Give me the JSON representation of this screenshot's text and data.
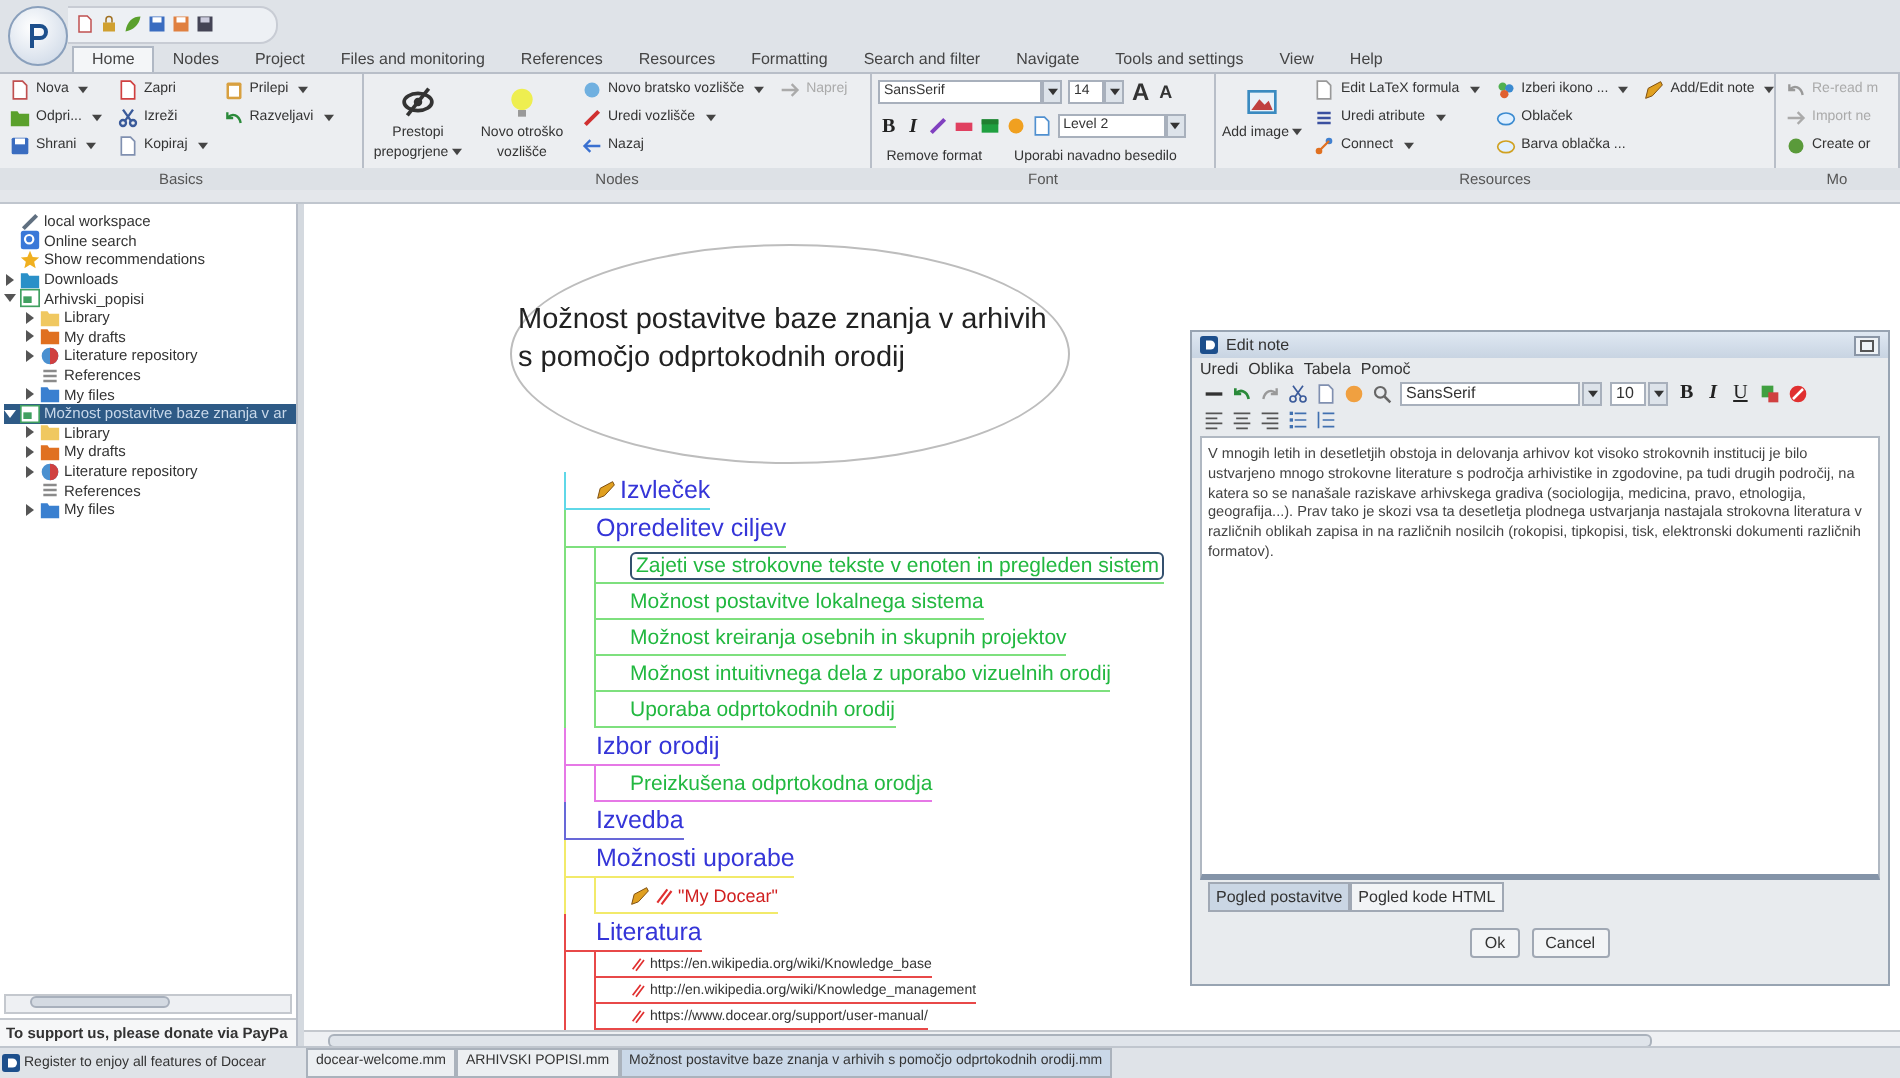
{
  "tabs": [
    {
      "label": "Home",
      "selected": true
    },
    {
      "label": "Nodes",
      "selected": false
    },
    {
      "label": "Project",
      "selected": false
    },
    {
      "label": "Files and monitoring",
      "selected": false
    },
    {
      "label": "References",
      "selected": false
    },
    {
      "label": "Resources",
      "selected": false
    },
    {
      "label": "Formatting",
      "selected": false
    },
    {
      "label": "Search and filter",
      "selected": false
    },
    {
      "label": "Navigate",
      "selected": false
    },
    {
      "label": "Tools and settings",
      "selected": false
    },
    {
      "label": "View",
      "selected": false
    },
    {
      "label": "Help",
      "selected": false
    }
  ],
  "ribbon": {
    "groups": [
      {
        "label": "Basics",
        "kind": "buttons",
        "columns": [
          {
            "kind": "small",
            "items": [
              {
                "label": "Nova",
                "kind": "new",
                "dropdown": true,
                "disabled": false
              },
              {
                "label": "Odpri...",
                "kind": "open",
                "dropdown": true,
                "disabled": false
              },
              {
                "label": "Shrani",
                "kind": "save",
                "dropdown": true,
                "disabled": false
              }
            ]
          },
          {
            "kind": "small",
            "items": [
              {
                "label": "Zapri",
                "kind": "close",
                "dropdown": false,
                "disabled": false
              },
              {
                "label": "Izreži",
                "kind": "cut",
                "dropdown": false,
                "disabled": false
              },
              {
                "label": "Kopiraj",
                "kind": "copy",
                "dropdown": true,
                "disabled": false
              }
            ]
          },
          {
            "kind": "small",
            "items": [
              {
                "label": "Prilepi",
                "kind": "paste",
                "dropdown": true,
                "disabled": false
              },
              {
                "label": "Razveljavi",
                "kind": "undo",
                "dropdown": true,
                "disabled": false
              }
            ]
          }
        ]
      },
      {
        "label": "Nodes",
        "kind": "buttons",
        "columns": [
          {
            "kind": "large",
            "items": [
              {
                "label": "Prestopi prepogrjene",
                "kind": "hide",
                "dropdown": true,
                "disabled": false
              }
            ]
          },
          {
            "kind": "large",
            "items": [
              {
                "label": "Novo otroško vozlišče",
                "kind": "child",
                "dropdown": false,
                "disabled": false
              }
            ]
          },
          {
            "kind": "small",
            "items": [
              {
                "label": "Novo bratsko vozlišče",
                "kind": "sibling",
                "dropdown": true,
                "disabled": false
              },
              {
                "label": "Uredi vozlišče",
                "kind": "edit",
                "dropdown": true,
                "disabled": false
              },
              {
                "label": "Nazaj",
                "kind": "back",
                "dropdown": false,
                "disabled": false
              }
            ]
          },
          {
            "kind": "small",
            "items": [
              {
                "label": "Naprej",
                "kind": "forward",
                "dropdown": false,
                "disabled": true
              }
            ]
          }
        ]
      },
      {
        "label": "Font",
        "kind": "font",
        "font_name": "SansSerif",
        "font_size": "14",
        "size_buttons": [
          "A",
          "A"
        ],
        "style_buttons": [
          "B",
          "I"
        ],
        "level": "Level 2",
        "actions": [
          "Remove format",
          "Uporabi navadno besedilo"
        ]
      },
      {
        "label": "Resources",
        "kind": "buttons",
        "columns": [
          {
            "kind": "large",
            "items": [
              {
                "label": "Add image",
                "kind": "image",
                "dropdown": true,
                "disabled": false
              }
            ]
          },
          {
            "kind": "small",
            "items": [
              {
                "label": "Edit LaTeX formula",
                "kind": "latex",
                "dropdown": true,
                "disabled": false
              },
              {
                "label": "Uredi atribute",
                "kind": "attributes",
                "dropdown": true,
                "disabled": false
              },
              {
                "label": "Connect",
                "kind": "connect",
                "dropdown": true,
                "disabled": false
              }
            ]
          },
          {
            "kind": "small",
            "items": [
              {
                "label": "Izberi ikono ...",
                "kind": "icon",
                "dropdown": true,
                "disabled": false
              },
              {
                "label": "Oblaček",
                "kind": "cloud",
                "dropdown": false,
                "disabled": false
              },
              {
                "label": "Barva oblačka ...",
                "kind": "cloudcolor",
                "dropdown": false,
                "disabled": false
              }
            ]
          },
          {
            "kind": "small",
            "items": [
              {
                "label": "Add/Edit note",
                "kind": "note",
                "dropdown": true,
                "disabled": false
              }
            ]
          }
        ]
      },
      {
        "label": "Mo",
        "kind": "buttons",
        "columns": [
          {
            "kind": "small",
            "items": [
              {
                "label": "Re-read m",
                "kind": "reread",
                "dropdown": false,
                "disabled": true
              },
              {
                "label": "Import ne",
                "kind": "import",
                "dropdown": false,
                "disabled": true
              },
              {
                "label": "Create or",
                "kind": "create",
                "dropdown": false,
                "disabled": false
              }
            ]
          }
        ]
      }
    ]
  },
  "sidebar": {
    "items": [
      {
        "label": "local workspace",
        "kind": "workspace",
        "selected": false
      },
      {
        "label": "Online search",
        "kind": "search",
        "selected": false
      },
      {
        "label": "Show recommendations",
        "kind": "star",
        "selected": false
      },
      {
        "label": "Downloads",
        "kind": "downloads",
        "selected": false,
        "expanded": false
      },
      {
        "label": "Arhivski_popisi",
        "kind": "project",
        "selected": false,
        "expanded": true,
        "children": [
          {
            "label": "Library",
            "kind": "library",
            "selected": false,
            "expanded": false
          },
          {
            "label": "My drafts",
            "kind": "drafts",
            "selected": false,
            "expanded": false
          },
          {
            "label": "Literature repository",
            "kind": "literature",
            "selected": false,
            "expanded": false
          },
          {
            "label": "References",
            "kind": "references",
            "selected": false
          },
          {
            "label": "My files",
            "kind": "files",
            "selected": false,
            "expanded": false
          }
        ]
      },
      {
        "label": "Možnost postavitve baze znanja v ar",
        "kind": "project",
        "selected": true,
        "expanded": true,
        "children": [
          {
            "label": "Library",
            "kind": "library",
            "selected": false,
            "expanded": false
          },
          {
            "label": "My drafts",
            "kind": "drafts",
            "selected": false,
            "expanded": false
          },
          {
            "label": "Literature repository",
            "kind": "literature",
            "selected": false,
            "expanded": false
          },
          {
            "label": "References",
            "kind": "references",
            "selected": false
          },
          {
            "label": "My files",
            "kind": "files",
            "selected": false,
            "expanded": false
          }
        ]
      }
    ],
    "footer": "To support us, please donate via PayPa"
  },
  "map": {
    "root": "Možnost postavitve baze znanja v arhivih s pomočjo odprtokodnih orodij",
    "nodes": [
      {
        "text": "Izvleček",
        "kind": "topic",
        "color": "#5fd8e8",
        "selected": false,
        "note": true
      },
      {
        "text": "Opredelitev ciljev",
        "kind": "topic",
        "color": "#7ee07e",
        "selected": false,
        "note": false,
        "children": [
          {
            "text": "Zajeti vse strokovne tekste v enoten in pregleden sistem",
            "kind": "topic",
            "color": "#7ee07e",
            "selected": true,
            "note": false
          },
          {
            "text": "Možnost postavitve lokalnega sistema",
            "kind": "topic",
            "color": "#7ee07e",
            "selected": false,
            "note": false
          },
          {
            "text": "Možnost kreiranja osebnih in skupnih projektov",
            "kind": "topic",
            "color": "#7ee07e",
            "selected": false,
            "note": false
          },
          {
            "text": "Možnost intuitivnega dela z uporabo vizuelnih orodij",
            "kind": "topic",
            "color": "#7ee07e",
            "selected": false,
            "note": false
          },
          {
            "text": "Uporaba odprtokodnih orodij",
            "kind": "topic",
            "color": "#7ee07e",
            "selected": false,
            "note": false
          }
        ]
      },
      {
        "text": "Izbor orodij",
        "kind": "topic",
        "color": "#e678e6",
        "selected": false,
        "note": false,
        "children": [
          {
            "text": "Preizkušena odprtokodna orodja",
            "kind": "topic",
            "color": "#e678e6",
            "selected": false,
            "note": false
          }
        ]
      },
      {
        "text": "Izvedba",
        "kind": "topic",
        "color": "#6868d8",
        "selected": false,
        "note": false
      },
      {
        "text": "Možnosti uporabe",
        "kind": "topic",
        "color": "#f2ea6a",
        "selected": false,
        "note": false,
        "children": [
          {
            "text": "\"My Docear\"",
            "kind": "reference",
            "color": "#f2ea6a",
            "selected": false,
            "note": true
          }
        ]
      },
      {
        "text": "Literatura",
        "kind": "topic",
        "color": "#e84848",
        "selected": false,
        "note": false,
        "children": [
          {
            "text": "https://en.wikipedia.org/wiki/Knowledge_base",
            "kind": "link",
            "color": "#e84848",
            "selected": false,
            "note": false
          },
          {
            "text": "http://en.wikipedia.org/wiki/Knowledge_management",
            "kind": "link",
            "color": "#e84848",
            "selected": false,
            "note": false
          },
          {
            "text": "https://www.docear.org/support/user-manual/",
            "kind": "link",
            "color": "#e84848",
            "selected": false,
            "note": false
          }
        ]
      }
    ]
  },
  "note_editor": {
    "title": "Edit note",
    "menu": [
      "Uredi",
      "Oblika",
      "Tabela",
      "Pomoč"
    ],
    "font_name": "SansSerif",
    "font_size": "10",
    "style_buttons": [
      "B",
      "I",
      "U"
    ],
    "text": "V mnogih letih in desetletjih obstoja in delovanja arhivov kot visoko strokovnih institucij je bilo ustvarjeno mnogo strokovne literature s področja arhivistike in zgodovine, pa tudi drugih področij, na katera so se nanašale raziskave arhivskega gradiva (sociologija, medicina, pravo, etnologija, geografija...). Prav tako je skozi vsa ta desetletja plodnega ustvarjanja nastajala strokovna literatura v različnih oblikah zapisa in na različnih nosilcih (rokopisi, tipkopisi, tisk, elektronski dokumenti različnih formatov).",
    "tabs": [
      {
        "label": "Pogled postavitve",
        "selected": true
      },
      {
        "label": "Pogled kode HTML",
        "selected": false
      }
    ],
    "buttons": [
      "Ok",
      "Cancel"
    ]
  },
  "status": "Register to enjoy all features of Docear",
  "map_tabs": [
    {
      "label": "docear-welcome.mm",
      "selected": false
    },
    {
      "label": "ARHIVSKI POPISI.mm",
      "selected": false
    },
    {
      "label": "Možnost postavitve baze znanja v arhivih s pomočjo odprtokodnih orodij.mm",
      "selected": true
    }
  ]
}
